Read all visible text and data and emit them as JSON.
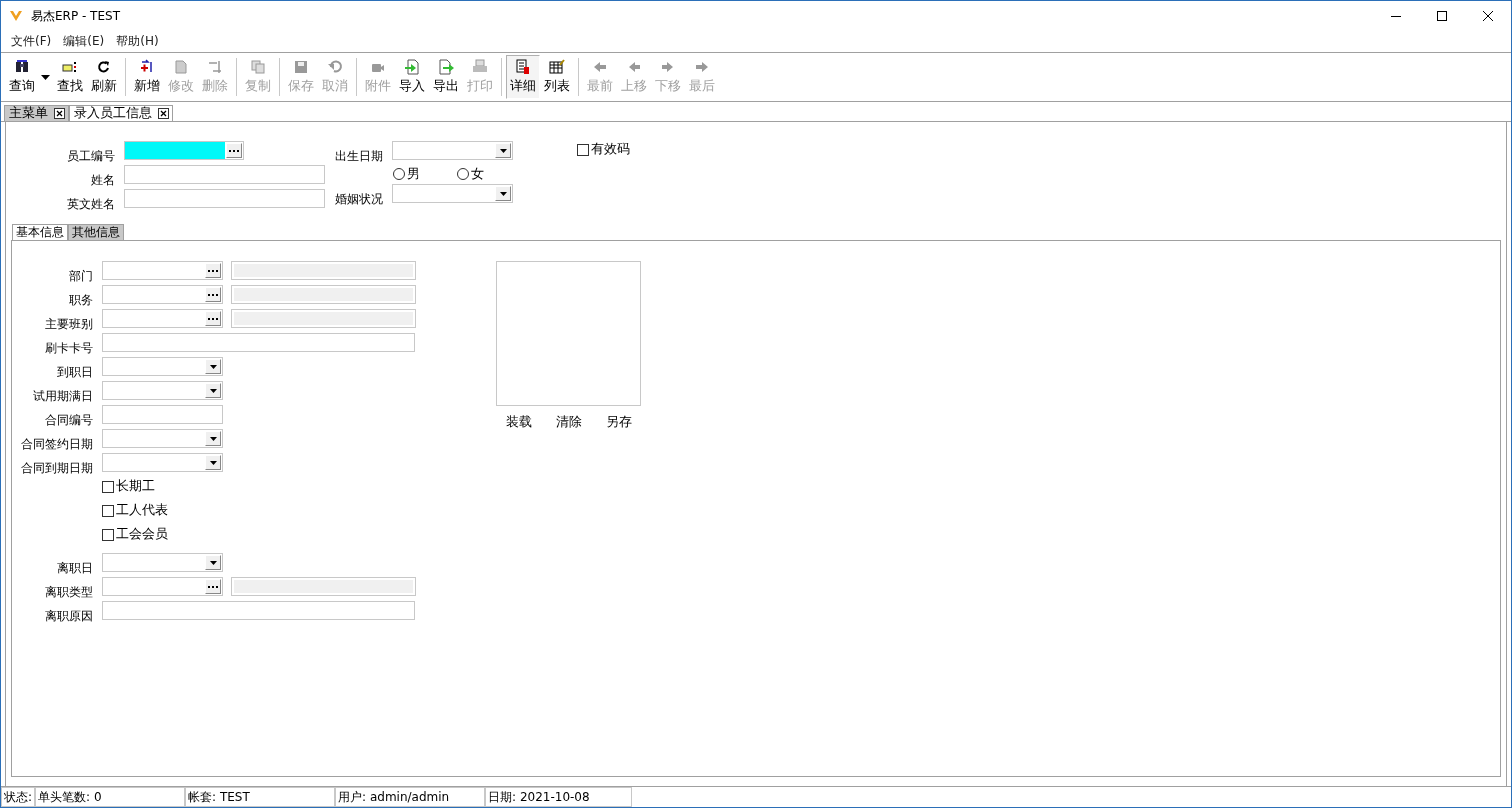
{
  "window": {
    "title": "易杰ERP - TEST"
  },
  "menu": [
    "文件(F)",
    "编辑(E)",
    "帮助(H)"
  ],
  "toolbar": {
    "groups": [
      [
        {
          "label": "查询",
          "disabled": false,
          "has_menu": true
        },
        {
          "label": "查找",
          "disabled": false
        },
        {
          "label": "刷新",
          "disabled": false
        }
      ],
      [
        {
          "label": "新增",
          "disabled": false
        },
        {
          "label": "修改",
          "disabled": true
        },
        {
          "label": "删除",
          "disabled": true
        }
      ],
      [
        {
          "label": "复制",
          "disabled": true
        }
      ],
      [
        {
          "label": "保存",
          "disabled": true
        },
        {
          "label": "取消",
          "disabled": true
        }
      ],
      [
        {
          "label": "附件",
          "disabled": true
        },
        {
          "label": "导入",
          "disabled": false
        },
        {
          "label": "导出",
          "disabled": false
        },
        {
          "label": "打印",
          "disabled": true
        }
      ],
      [
        {
          "label": "详细",
          "disabled": false,
          "selected": true
        },
        {
          "label": "列表",
          "disabled": false,
          "selected": false
        }
      ],
      [
        {
          "label": "最前",
          "disabled": true
        },
        {
          "label": "上移",
          "disabled": true
        },
        {
          "label": "下移",
          "disabled": true
        },
        {
          "label": "最后",
          "disabled": true
        }
      ]
    ]
  },
  "doc_tabs": [
    {
      "label": "主菜单",
      "selected": false
    },
    {
      "label": "录入员工信息",
      "selected": true
    }
  ],
  "header": {
    "fields": [
      {
        "label": "员工编号",
        "kind": "lookup",
        "focused": true
      },
      {
        "label": "姓名",
        "kind": "text",
        "focused": false
      },
      {
        "label": "英文姓名",
        "kind": "text",
        "focused": false
      }
    ],
    "birth_date": {
      "label": "出生日期"
    },
    "gender": [
      {
        "label": "男",
        "selected": false
      },
      {
        "label": "女",
        "selected": false
      }
    ],
    "marital_status": {
      "label": "婚姻状况"
    },
    "valid_code": {
      "label": "有效码",
      "checked": false
    }
  },
  "inner_tabs": [
    {
      "label": "基本信息",
      "selected": true
    },
    {
      "label": "其他信息",
      "selected": false
    }
  ],
  "fields": [
    {
      "label": "部门",
      "kind": "lookup"
    },
    {
      "label": "职务",
      "kind": "lookup"
    },
    {
      "label": "主要班别",
      "kind": "lookup"
    },
    {
      "label": "刷卡卡号",
      "kind": "wide"
    },
    {
      "label": "到职日",
      "kind": "date"
    },
    {
      "label": "试用期满日",
      "kind": "date"
    },
    {
      "label": "合同编号",
      "kind": "text"
    },
    {
      "label": "合同签约日期",
      "kind": "date"
    },
    {
      "label": "合同到期日期",
      "kind": "date"
    },
    {
      "label": "长期工",
      "kind": "checkbox",
      "checked": false
    },
    {
      "label": "工人代表",
      "kind": "checkbox",
      "checked": false
    },
    {
      "label": "工会会员",
      "kind": "checkbox",
      "checked": false
    },
    {
      "label": "离职日",
      "kind": "date"
    },
    {
      "label": "离职类型",
      "kind": "lookup"
    },
    {
      "label": "离职原因",
      "kind": "wide"
    }
  ],
  "photo": {
    "buttons": [
      "装载",
      "清除",
      "另存"
    ]
  },
  "status_bar": [
    {
      "label": "状态:"
    },
    {
      "label": "单头笔数: 0"
    },
    {
      "label": "帐套: TEST"
    },
    {
      "label": "用户: admin/admin"
    },
    {
      "label": "日期: 2021-10-08"
    }
  ]
}
